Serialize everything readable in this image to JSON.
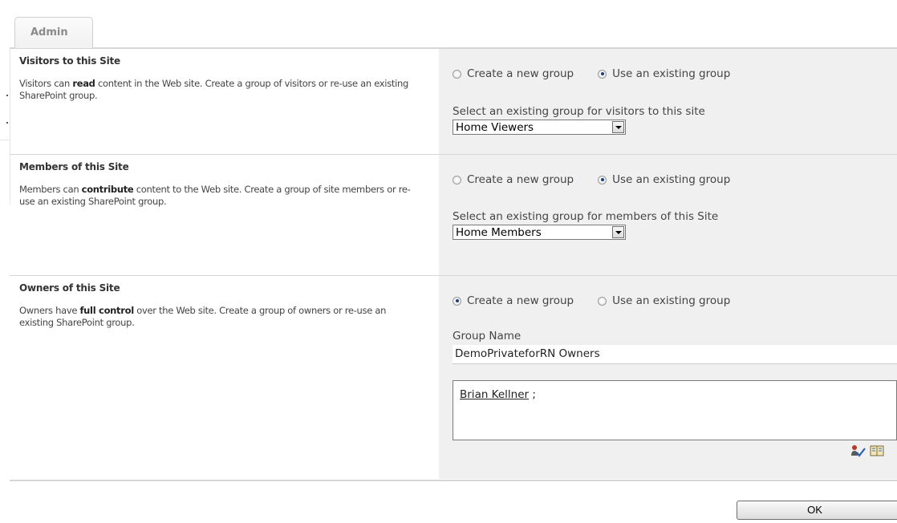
{
  "tab": {
    "label": "Admin"
  },
  "visitors": {
    "title": "Visitors to this Site",
    "desc_before": "Visitors can ",
    "desc_bold": "read",
    "desc_after": " content in the Web site. Create a group of visitors or re-use an existing SharePoint group.",
    "radio_new_label": "Create a new group",
    "radio_existing_label": "Use an existing group",
    "selected_option": "Use an existing group",
    "select_label": "Select an existing group for visitors to this site",
    "select_value": "Home Viewers"
  },
  "members": {
    "title": "Members of this Site",
    "desc_before": "Members can ",
    "desc_bold": "contribute",
    "desc_after": " content to the Web site. Create a group of site members or re-use an existing SharePoint group.",
    "radio_new_label": "Create a new group",
    "radio_existing_label": "Use an existing group",
    "selected_option": "Use an existing group",
    "select_label": "Select an existing group for members of this Site",
    "select_value": "Home Members"
  },
  "owners": {
    "title": "Owners of this Site",
    "desc_before": "Owners have ",
    "desc_bold": "full control",
    "desc_after": " over the Web site. Create a group of owners or re-use an existing SharePoint group.",
    "radio_new_label": "Create a new group",
    "radio_existing_label": "Use an existing group",
    "selected_option": "Create a new group",
    "group_name_label": "Group Name",
    "group_name_value": "DemoPrivateforRN Owners",
    "people": "Brian Kellner",
    "people_separator": " ;"
  },
  "buttons": {
    "ok_label": "OK"
  },
  "colors": {
    "right_panel_bg": "#f0f0f0",
    "separator": "#d6d6d6",
    "radio_selected": "#1e3f7a"
  },
  "icons": [
    "check-names-icon",
    "browse-address-book-icon",
    "dropdown-arrow-icon"
  ]
}
